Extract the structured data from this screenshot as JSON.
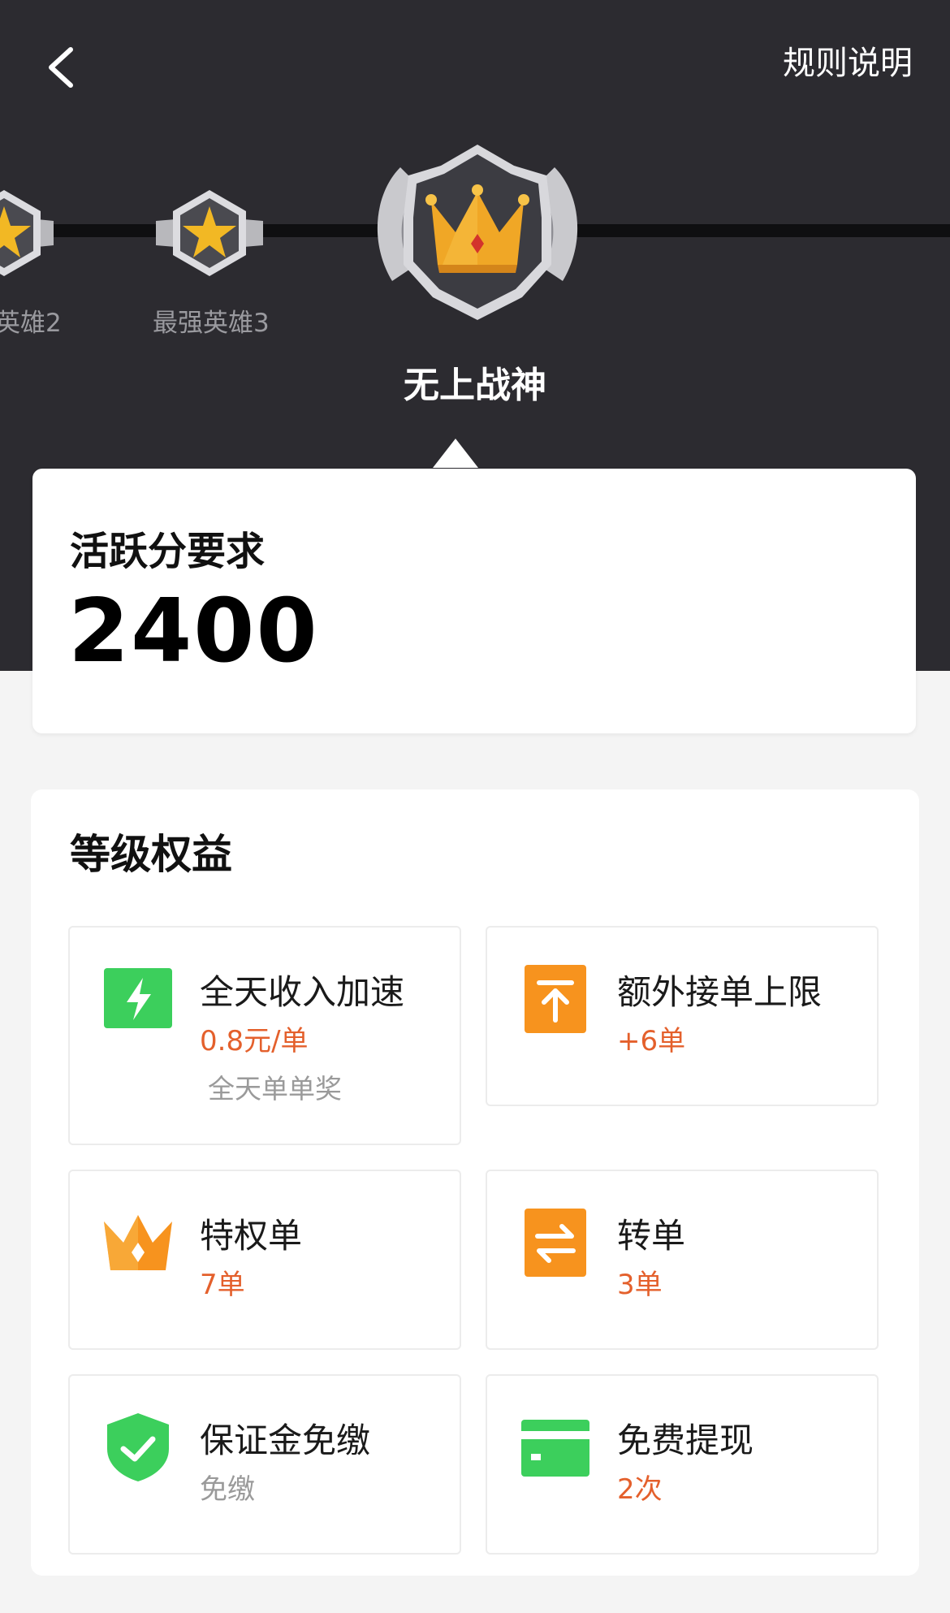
{
  "header": {
    "rules_label": "规则说明"
  },
  "levels": [
    {
      "label": "英雄2",
      "icon": "star-badge-icon"
    },
    {
      "label": "最强英雄3",
      "icon": "star-badge-icon"
    }
  ],
  "current_level": {
    "title": "无上战神",
    "icon": "crown-badge-icon"
  },
  "score": {
    "label": "活跃分要求",
    "value": "2400"
  },
  "benefits": {
    "title": "等级权益",
    "items": [
      {
        "name": "全天收入加速",
        "value": "0.8元/单",
        "sub": "全天单单奖",
        "icon": "lightning-icon",
        "color": "#3ccf5c"
      },
      {
        "name": "额外接单上限",
        "value": "+6单",
        "icon": "arrow-up-icon",
        "color": "#f7931e"
      },
      {
        "name": "特权单",
        "value": "7单",
        "icon": "crown-icon",
        "color": "#f7931e"
      },
      {
        "name": "转单",
        "value": "3单",
        "icon": "swap-icon",
        "color": "#f7931e"
      },
      {
        "name": "保证金免缴",
        "value": "免缴",
        "icon": "shield-check-icon",
        "color": "#3ccf5c"
      },
      {
        "name": "免费提现",
        "value": "2次",
        "icon": "card-icon",
        "color": "#3ccf5c"
      }
    ]
  }
}
